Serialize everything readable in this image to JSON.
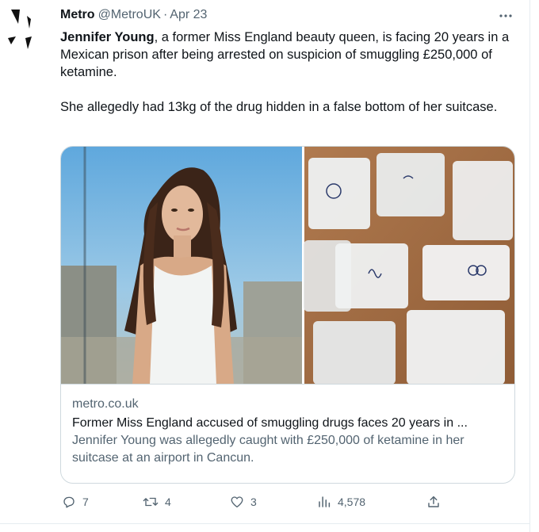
{
  "tweet": {
    "author_name": "Metro",
    "author_handle": "@MetroUK",
    "separator": "·",
    "date": "Apr 23",
    "text_bold": "Jennifer Young",
    "text_rest": ", a former Miss England beauty queen, is facing 20 years in a Mexican prison after being arrested on suspicion of smuggling £250,000 of ketamine.",
    "text_second": "She allegedly had 13kg of the drug hidden in a false bottom of her suitcase."
  },
  "card": {
    "domain": "metro.co.uk",
    "title": "Former Miss England accused of smuggling drugs faces 20 years in ...",
    "description": "Jennifer Young was allegedly caught with £250,000 of ketamine in her suitcase at an airport in Cancun."
  },
  "actions": {
    "replies": "7",
    "retweets": "4",
    "likes": "3",
    "views": "4,578"
  },
  "icons": {
    "more": "more-dots-icon",
    "reply": "reply-icon",
    "retweet": "retweet-icon",
    "like": "heart-icon",
    "views": "views-bar-chart-icon",
    "share": "share-icon"
  },
  "colors": {
    "text_primary": "#0f1419",
    "text_secondary": "#536471",
    "border": "#cfd9de"
  }
}
